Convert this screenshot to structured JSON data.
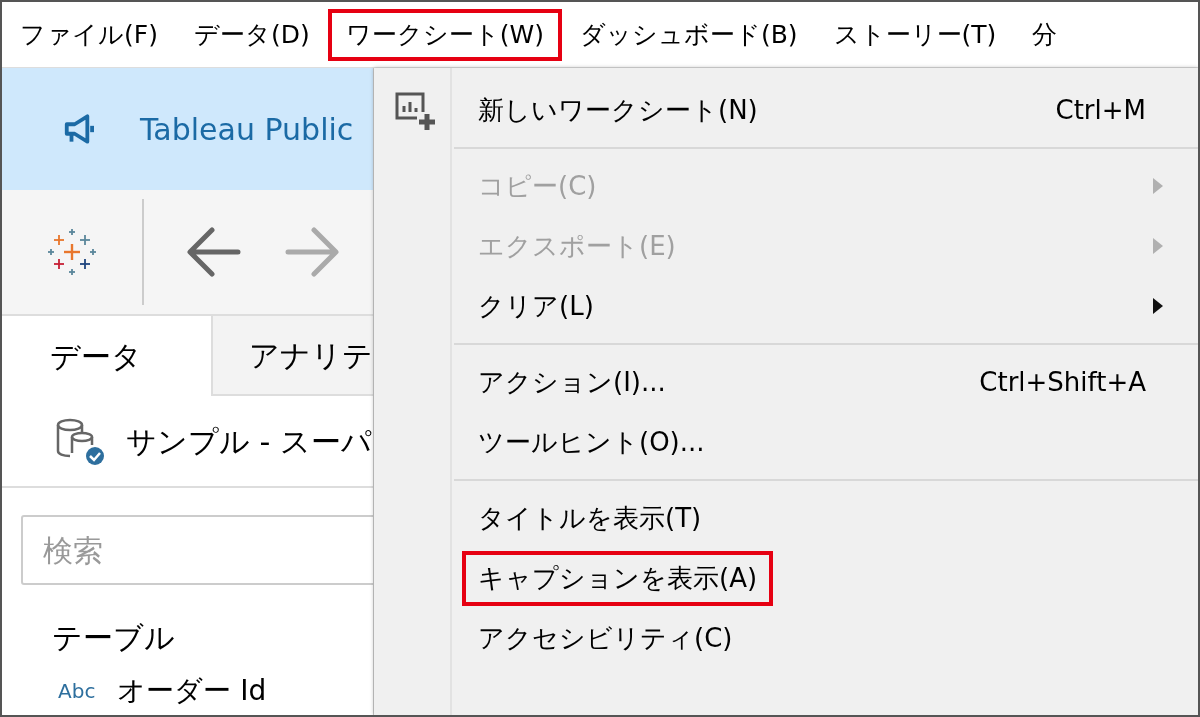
{
  "menu_bar": [
    {
      "label": "ファイル(F)",
      "highlighted": false
    },
    {
      "label": "データ(D)",
      "highlighted": false
    },
    {
      "label": "ワークシート(W)",
      "highlighted": true
    },
    {
      "label": "ダッシュボード(B)",
      "highlighted": false
    },
    {
      "label": "ストーリー(T)",
      "highlighted": false
    },
    {
      "label": "分",
      "highlighted": false
    }
  ],
  "sidebar": {
    "banner": "Tableau Public",
    "tabs": [
      {
        "label": "データ",
        "selected": true
      },
      {
        "label": "アナリテ",
        "selected": false
      }
    ],
    "data_source": "サンプル - スーパ",
    "search": {
      "placeholder": "検索"
    },
    "section": "テーブル",
    "field": {
      "type": "Abc",
      "name": "オーダー Id"
    }
  },
  "dropdown": [
    {
      "kind": "item",
      "label": "新しいワークシート(N)",
      "shortcut": "Ctrl+M",
      "icon": true,
      "submenu": false,
      "disabled": false,
      "highlighted": false
    },
    {
      "kind": "separator"
    },
    {
      "kind": "item",
      "label": "コピー(C)",
      "icon": false,
      "submenu": true,
      "disabled": true,
      "highlighted": false
    },
    {
      "kind": "item",
      "label": "エクスポート(E)",
      "icon": false,
      "submenu": true,
      "disabled": true,
      "highlighted": false
    },
    {
      "kind": "item",
      "label": "クリア(L)",
      "icon": false,
      "submenu": true,
      "disabled": false,
      "highlighted": false
    },
    {
      "kind": "separator"
    },
    {
      "kind": "item",
      "label": "アクション(I)...",
      "shortcut": "Ctrl+Shift+A",
      "icon": false,
      "submenu": false,
      "disabled": false,
      "highlighted": false
    },
    {
      "kind": "item",
      "label": "ツールヒント(O)...",
      "icon": false,
      "submenu": false,
      "disabled": false,
      "highlighted": false
    },
    {
      "kind": "separator"
    },
    {
      "kind": "item",
      "label": "タイトルを表示(T)",
      "icon": false,
      "submenu": false,
      "disabled": false,
      "highlighted": false
    },
    {
      "kind": "item",
      "label": "キャプションを表示(A)",
      "icon": false,
      "submenu": false,
      "disabled": false,
      "highlighted": true
    },
    {
      "kind": "item",
      "label": "アクセシビリティ(C)",
      "icon": false,
      "submenu": false,
      "disabled": false,
      "highlighted": false
    }
  ]
}
